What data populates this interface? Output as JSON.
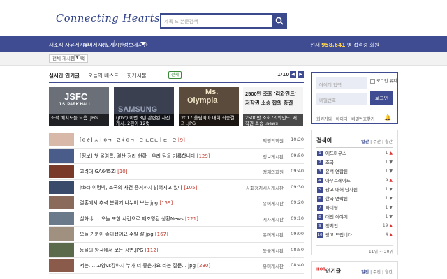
{
  "brand": {
    "logo": "Connecting Hearts"
  },
  "search": {
    "placeholder": "제목 & 본문검색"
  },
  "nav": {
    "items": [
      "새소식",
      "자유게시판",
      "유머게시판",
      "공포게시판",
      "정보게시판"
    ],
    "counter_label": "현재",
    "counter_value": "958,641",
    "counter_suffix": "명 접속중 회원"
  },
  "subbar": {
    "select_value": "전체 게시판 선택"
  },
  "main": {
    "title": "실시간 인기글",
    "tab_today": "오늘의 베스트",
    "tab_hot": "핫게시물",
    "pill": "전체",
    "page": "1/10",
    "prev": "◀",
    "next": "▶"
  },
  "thumbs": [
    {
      "big": "JSFC",
      "sub": "J.S. PARK HALL",
      "caption": "좌석 배치도를 모음 .JPG",
      "bg": "#6a6f78"
    },
    {
      "big": "SAMSUNG",
      "sub": "",
      "caption": "(jtbc) 이번 3년 관련된 사진 게시. 2편이 12컷",
      "bg": "#3b4050"
    },
    {
      "big": "Ms.",
      "sub": "Olympia",
      "caption": "2017 올림피아 대회 최종결과 .JPG",
      "bg": "#5a4b3d"
    },
    {
      "big": "2500만 조회 '리와인드'",
      "sub": "저작권 소송 합의 종결",
      "caption": "2500만 조회 '리와인드' 저작권 소송 .news",
      "bg": "#f4f4f4"
    }
  ],
  "rows": [
    {
      "title": "[ㅇㅎ] ㅅㅣㅇㄱㅡㄹㅕㅇㄱㅡㄹ ㄴㅌㄴㅏㄷㅡㄹ",
      "cmt": "[9]",
      "writer": "익명의회원",
      "time": "10:20",
      "img": "#d8b8a8"
    },
    {
      "title": "[정보] 첫 올여름, 결산 정리 현황 - 우리 팀을 기록합니다",
      "cmt": "[129]",
      "writer": "정보게시판",
      "time": "09:50",
      "img": "#4a5d8a"
    },
    {
      "title": "고려대 GA645Zi",
      "cmt": "[10]",
      "writer": "정재의회원",
      "time": "09:40",
      "img": "#7a3a2a"
    },
    {
      "title": "jtbc) 이명박, 조국의 사건 증거까지 밝혀지고 있다",
      "cmt": "[105]",
      "writer": "사회정치시사게시판",
      "time": "09:30",
      "img": "#3a4a6a"
    },
    {
      "title": "결혼에서 추석 분위기 나누어 보는.jpg",
      "cmt": "[159]",
      "writer": "유머게시판",
      "time": "09:20",
      "img": "#8a6a5a"
    },
    {
      "title": "실화냐…. 오늘 또한 사건으로 재조명된 상황News",
      "cmt": "[221]",
      "writer": "시사게시판",
      "time": "09:10",
      "img": "#6a7a8a"
    },
    {
      "title": "오늘 기분이 좋아졌어요 주말 잘.jpg",
      "cmt": "[167]",
      "writer": "유머게시판",
      "time": "09:00",
      "img": "#a09080"
    },
    {
      "title": "동물의 왕국에서 보는 장면.JPG",
      "cmt": "[112]",
      "writer": "동물게시판",
      "time": "08:50",
      "img": "#5a6a4a"
    },
    {
      "title": "저는…. 고양vs강아지 누가 더 좋은가요 라는 질문... jpg",
      "cmt": "[230]",
      "writer": "유머게시판",
      "time": "08:40",
      "img": "#8a5a4a"
    }
  ],
  "login": {
    "id_placeholder": "아이디 입력",
    "pw_placeholder": "비밀번호",
    "keep": "로그인 유지",
    "button": "로그인",
    "links": "회원가입 · 아이디 · 비밀번호찾기"
  },
  "rank": {
    "title": "검색어",
    "tab1": "일간",
    "tab2": "주간",
    "tab3": "월간",
    "items": [
      {
        "n": "1",
        "label": "애드마우스",
        "chg": "1",
        "dir": "▲"
      },
      {
        "n": "2",
        "label": "조국",
        "chg": "1",
        "dir": "▼"
      },
      {
        "n": "3",
        "label": "윤석 연합원",
        "chg": "1",
        "dir": "▼"
      },
      {
        "n": "4",
        "label": "아무르레이드",
        "chg": "9",
        "dir": "▲"
      },
      {
        "n": "5",
        "label": "광고 대해 당사원",
        "chg": "1",
        "dir": "▼"
      },
      {
        "n": "6",
        "label": "한국 연락원",
        "chg": "1",
        "dir": "▼"
      },
      {
        "n": "7",
        "label": "파이팅",
        "chg": "1",
        "dir": "▼"
      },
      {
        "n": "8",
        "label": "대전 이야기",
        "chg": "1",
        "dir": "▼"
      },
      {
        "n": "9",
        "label": "정치인",
        "chg": "19",
        "dir": "▲"
      },
      {
        "n": "10",
        "label": "광고 드립니다",
        "chg": "4",
        "dir": "▲"
      }
    ],
    "more": "11위 ~ 20위"
  },
  "hot": {
    "title": "인기글",
    "badge": "HOT",
    "tab1": "일간",
    "tab2": "주간",
    "tab3": "월간"
  },
  "colors": {
    "brand": "#3f4c92",
    "accent": "#ffd34f",
    "comment": "#c0392b"
  }
}
